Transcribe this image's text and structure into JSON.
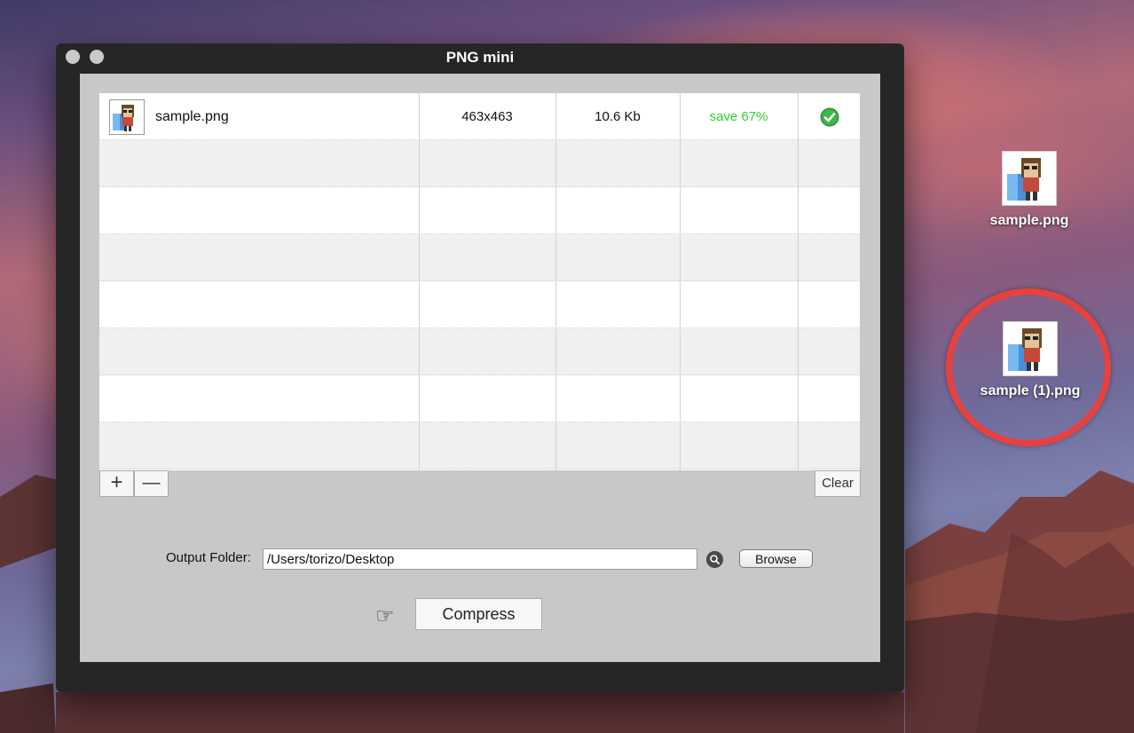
{
  "window": {
    "title": "PNG mini"
  },
  "table": {
    "rows": [
      {
        "name": "sample.png",
        "dimensions": "463x463",
        "size": "10.6 Kb",
        "saving": "save 67%",
        "status_icon": "check-circle-icon"
      }
    ],
    "status_color": "#2fd12f",
    "add_label": "+",
    "remove_label": "—",
    "clear_label": "Clear"
  },
  "output": {
    "label": "Output Folder:",
    "path": "/Users/torizo/Desktop",
    "search_icon": "magnifier-icon",
    "browse_label": "Browse"
  },
  "compress": {
    "hand_icon": "☞",
    "label": "Compress"
  },
  "desktop": {
    "files": [
      {
        "label": "sample.png"
      },
      {
        "label": "sample (1).png",
        "highlighted": true
      }
    ],
    "highlight_color": "#e8413d"
  }
}
